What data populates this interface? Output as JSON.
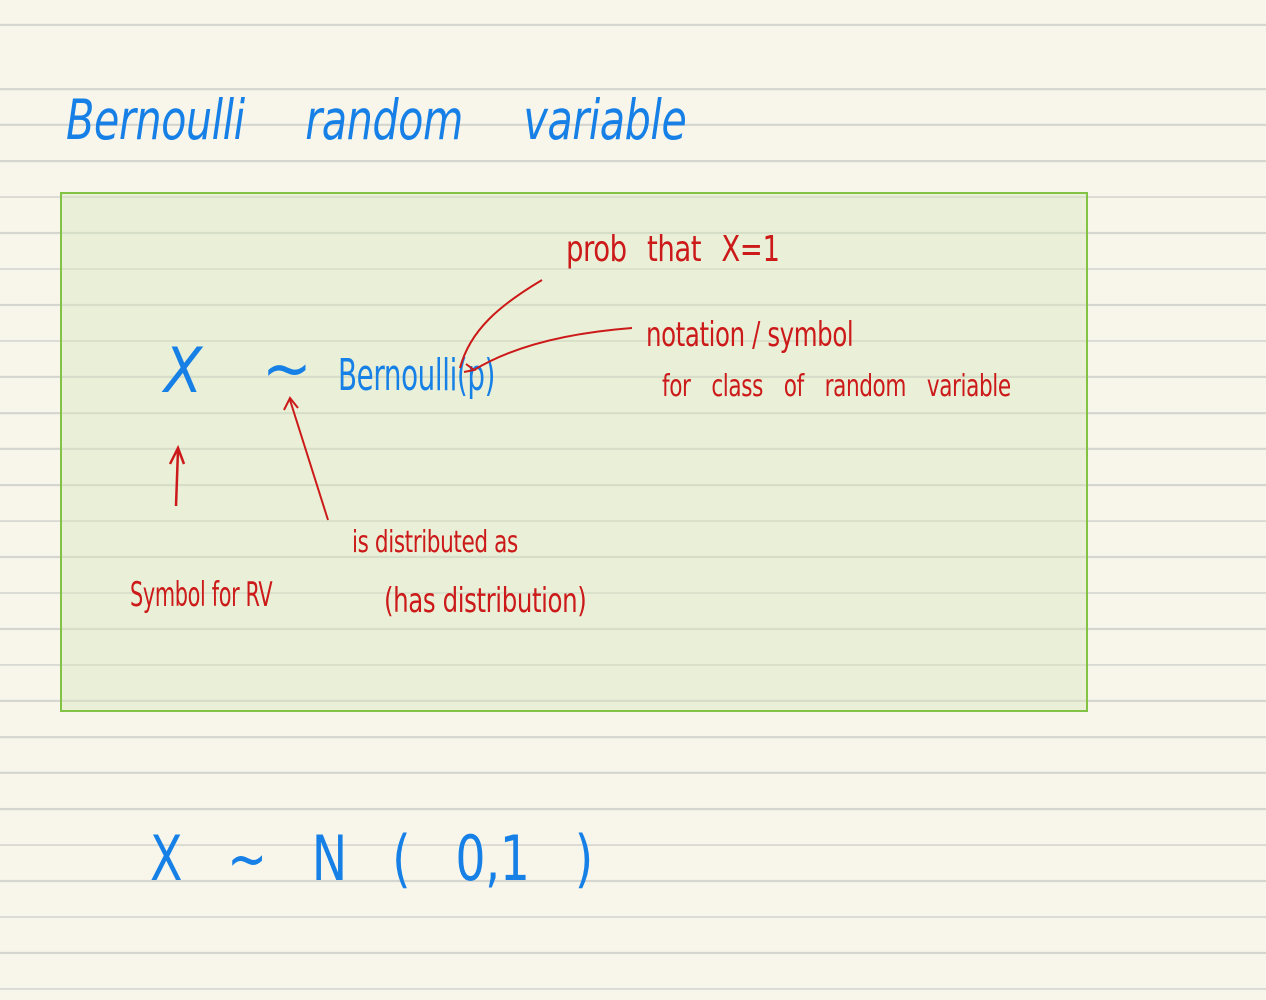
{
  "page": {
    "title": "Bernoulli random variable"
  },
  "box": {
    "random_variable": "X",
    "relation_symbol": "~",
    "distribution": "Bernoulli(p)"
  },
  "annotations": {
    "prob_of_one": "prob that X=1",
    "notation": "notation / symbol",
    "notation_detail": "for class of random variable",
    "distributed_as": "is distributed as",
    "has_distribution": "(has distribution)",
    "symbol_for_rv": "Symbol for RV"
  },
  "example": {
    "expression": "X ~ N ( 0,1 )"
  },
  "colors": {
    "ink_blue": "#1680e6",
    "ink_red": "#cc1a1a",
    "box_border": "#82c346",
    "box_fill": "#e6eed6",
    "paper": "#f8f6eb",
    "rule_line": "#d6d6d1"
  }
}
